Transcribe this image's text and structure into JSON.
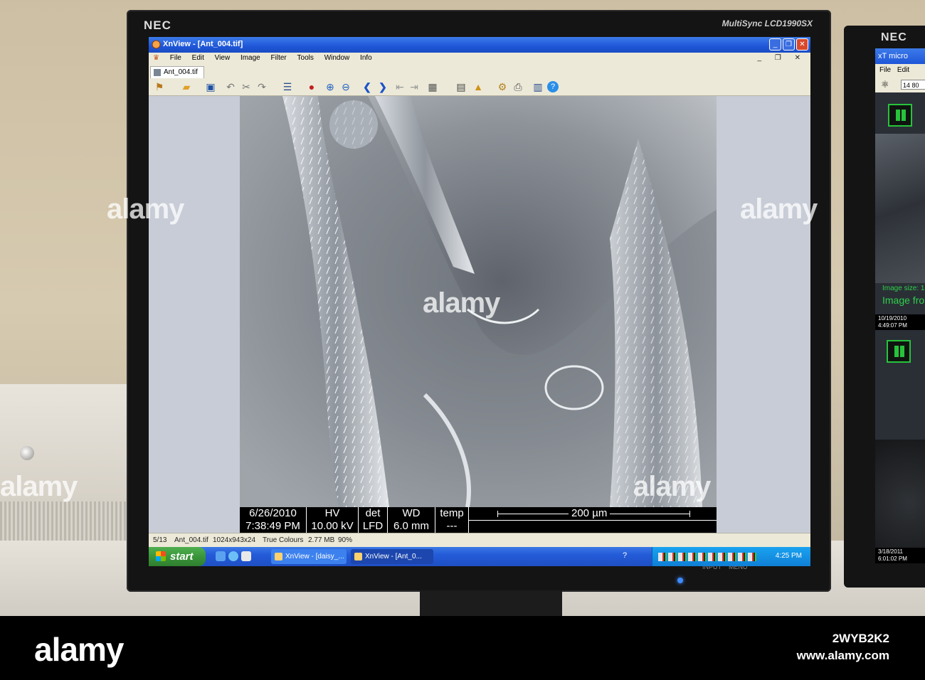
{
  "main_window": {
    "title": "XnView - [Ant_004.tif]",
    "menu": [
      "File",
      "Edit",
      "View",
      "Image",
      "Filter",
      "Tools",
      "Window",
      "Info"
    ],
    "tab_label": "Ant_004.tif"
  },
  "sem_databar": {
    "date": "6/26/2010",
    "time": "7:38:49 PM",
    "hv_label": "HV",
    "hv_value": "10.00 kV",
    "det_label": "det",
    "det_value": "LFD",
    "wd_label": "WD",
    "wd_value": "6.0 mm",
    "temp_label": "temp",
    "temp_value": "---",
    "scale_label": "200 µm"
  },
  "status_bar": {
    "index": "5/13",
    "filename": "Ant_004.tif",
    "dimensions": "1024x943x24",
    "color_mode": "True Colours",
    "file_size": "2.77 MB",
    "zoom": "90%"
  },
  "taskbar": {
    "start_label": "start",
    "tasks": [
      {
        "label": "XnView - [daisy_..."
      },
      {
        "label": "XnView - [Ant_0..."
      }
    ],
    "clock": "4:25 PM"
  },
  "monitor": {
    "brand": "NEC",
    "model": "MultiSync LCD1990SX",
    "input_label": "INPUT",
    "menu_label": "MENU"
  },
  "second_monitor": {
    "brand": "NEC",
    "title": "xT micro",
    "menu": [
      "File",
      "Edit"
    ],
    "field_value": "14 80",
    "image_size_label": "Image size: 1",
    "image_from_label": "Image fro",
    "stamp1_date": "10/19/2010",
    "stamp1_time": "4:49:07 PM",
    "stamp2_date": "3/18/2011",
    "stamp2_time": "6:01:02 PM"
  },
  "watermark": {
    "logo_text": "alamy",
    "image_id": "2WYB2K2",
    "url": "www.alamy.com"
  },
  "colors": {
    "xp_title_blue": "#1f56d8",
    "xp_start_green": "#3a953a",
    "sem_bar_black": "#000000",
    "status_green": "#27c33b"
  }
}
